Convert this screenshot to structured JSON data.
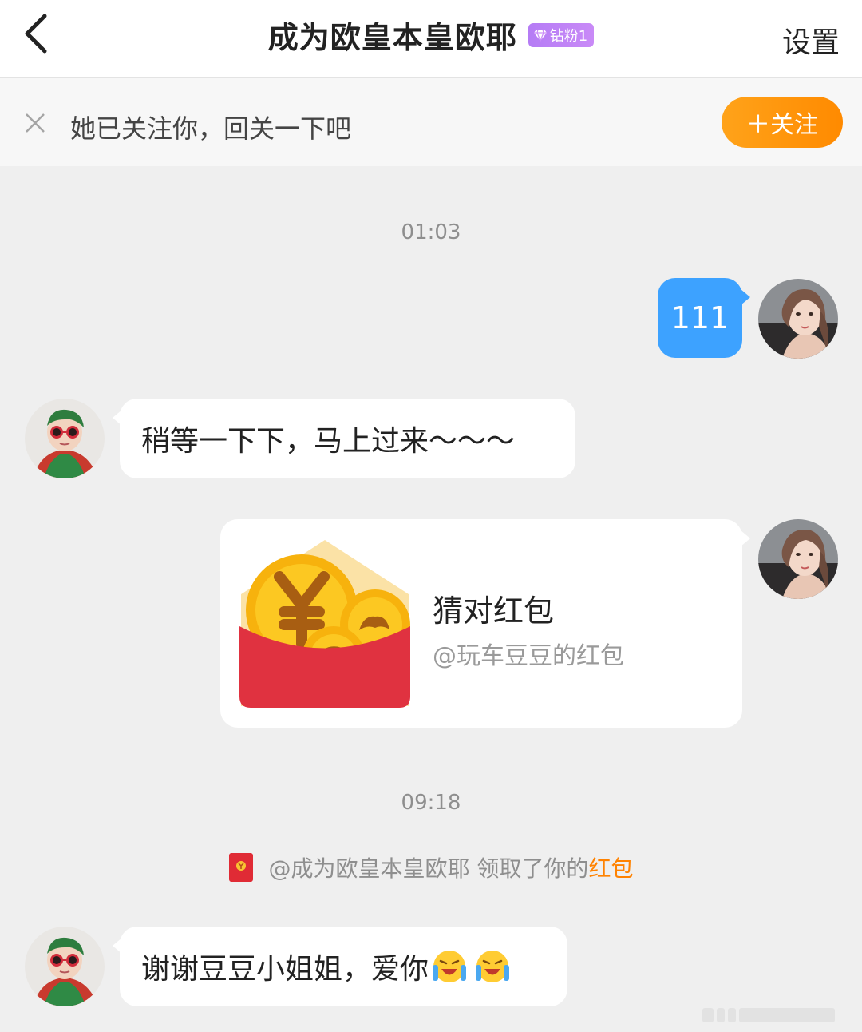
{
  "header": {
    "title": "成为欧皇本皇欧耶",
    "badge_label": "钻粉1",
    "settings_label": "设置",
    "back_icon": "chevron-left-icon"
  },
  "follow_bar": {
    "message": "她已关注你，回关一下吧",
    "follow_button": "＋关注",
    "accent": "#ff8a00"
  },
  "chat": {
    "timestamps": [
      "01:03",
      "09:18"
    ],
    "messages": [
      {
        "from": "me",
        "text": "111"
      },
      {
        "from": "other",
        "text": "稍等一下下，马上过来～～～"
      },
      {
        "from": "me",
        "type": "red-packet",
        "title": "猜对红包",
        "subtitle": "@玩车豆豆的红包"
      },
      {
        "from": "other",
        "text": "谢谢豆豆小姐姐，爱你",
        "emojis": [
          "crying-laugh-emoji",
          "crying-laugh-emoji"
        ]
      }
    ],
    "notice": {
      "prefix": "@成为欧皇本皇欧耶 领取了你的",
      "link": "红包"
    },
    "colors": {
      "my_bubble": "#3da2ff",
      "their_bubble": "#ffffff",
      "background": "#efefef"
    }
  }
}
